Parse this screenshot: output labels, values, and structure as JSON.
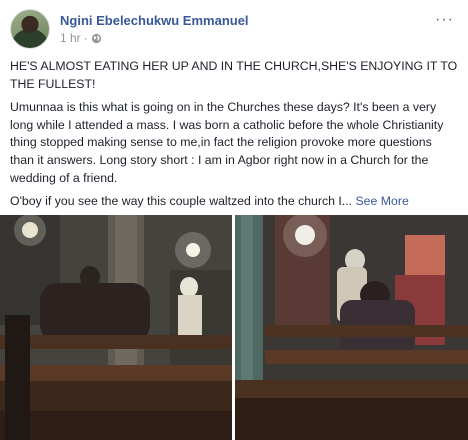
{
  "post": {
    "author": "Ngini Ebelechukwu Emmanuel",
    "time": "1 hr",
    "privacy_icon": "globe-icon",
    "more_icon": "ellipsis-icon",
    "more_label": "···",
    "paragraphs": [
      "HE'S ALMOST EATING HER UP AND IN THE CHURCH,SHE'S ENJOYING IT TO THE FULLEST!",
      "Umunnaa is this what is going on in the Churches these days? It's been a very long while I attended a mass. I was born a catholic before the whole Christianity thing stopped making sense to me,in fact the religion provoke more questions than it answers. Long story short : I am in Agbor right now in a Church for the wedding of a friend."
    ],
    "last_line": "O'boy if you see the way this couple waltzed into the church I...",
    "see_more": "See More"
  },
  "colors": {
    "link": "#385898",
    "meta": "#90949c",
    "text": "#1d2129"
  }
}
